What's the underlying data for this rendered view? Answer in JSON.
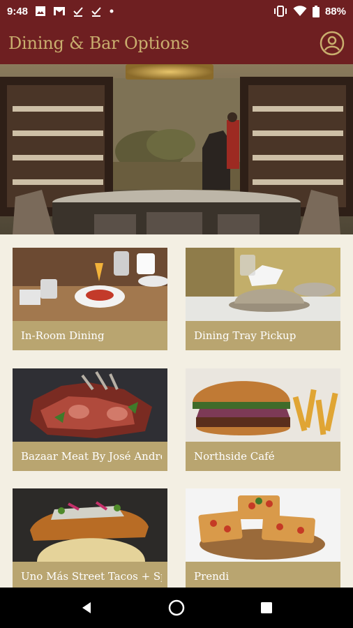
{
  "status_bar": {
    "time": "9:48",
    "battery": "88%",
    "left_icons": [
      "image-icon",
      "gmail-icon",
      "download-done-icon",
      "download-done-icon",
      "dot-icon"
    ],
    "right_icons": [
      "vibrate-icon",
      "wifi-icon",
      "battery-icon"
    ]
  },
  "app_bar": {
    "title": "Dining & Bar Options",
    "profile_icon": "account-circle-icon"
  },
  "hero": {
    "description_icon": "restaurant-hero-image"
  },
  "cards": [
    {
      "label": "In-Room Dining"
    },
    {
      "label": "Dining Tray Pickup"
    },
    {
      "label": "Bazaar Meat By José Andrés"
    },
    {
      "label": "Northside Café"
    },
    {
      "label": "Uno Más Street Tacos + Sp..."
    },
    {
      "label": "Prendi"
    }
  ],
  "colors": {
    "brand_maroon": "#6e1f21",
    "gold": "#c9ae6e",
    "card_label_bg": "#b9a570",
    "page_bg": "#f3efe3"
  }
}
